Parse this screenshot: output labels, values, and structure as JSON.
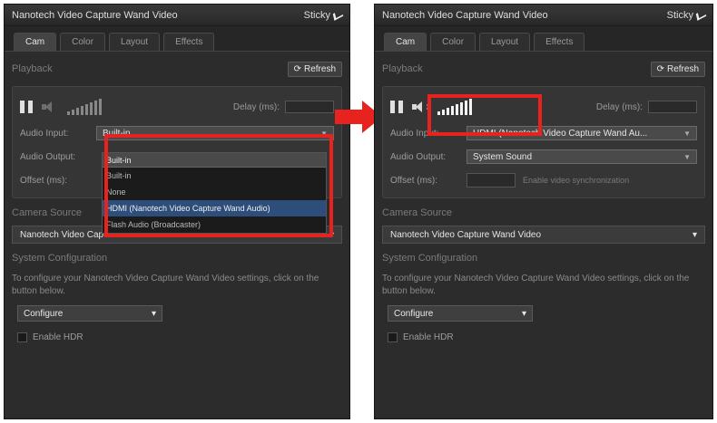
{
  "colors": {
    "highlight": "#e8231f",
    "panel_bg": "#2c2c2c",
    "selection": "#2d4d7a"
  },
  "window_title": "Nanotech Video Capture Wand Video",
  "sticky_label": "Sticky",
  "tabs": [
    "Cam",
    "Color",
    "Layout",
    "Effects"
  ],
  "refresh_label": "Refresh",
  "left": {
    "playback_title": "Playback",
    "delay_label": "Delay (ms):",
    "audio_input_label": "Audio Input:",
    "audio_output_label": "Audio Output:",
    "offset_label": "Offset (ms):",
    "audio_input_value": "Built-in",
    "dropdown_options": [
      "Built-in",
      "None",
      "HDMI (Nanotech Video Capture Wand Audio)",
      "Flash Audio (Broadcaster)"
    ],
    "selected_index": 2,
    "camera_source_label": "Camera Source",
    "camera_value": "Nanotech Video Capture Wand Video",
    "system_config_label": "System Configuration",
    "config_desc": "To configure your Nanotech Video Capture Wand Video settings, click on the button below.",
    "configure_label": "Configure",
    "enable_hdr_label": "Enable HDR"
  },
  "right": {
    "playback_title": "Playback",
    "delay_label": "Delay (ms):",
    "audio_input_label": "Audio Input:",
    "audio_output_label": "Audio Output:",
    "offset_label": "Offset (ms):",
    "audio_input_value": "HDMI (Nanotech Video Capture Wand Au...",
    "audio_output_value": "System Sound",
    "offset_hint": "Enable video synchronization",
    "camera_source_label": "Camera Source",
    "camera_value": "Nanotech Video Capture Wand Video",
    "system_config_label": "System Configuration",
    "config_desc": "To configure your Nanotech Video Capture Wand Video settings, click on the button below.",
    "configure_label": "Configure",
    "enable_hdr_label": "Enable HDR"
  }
}
